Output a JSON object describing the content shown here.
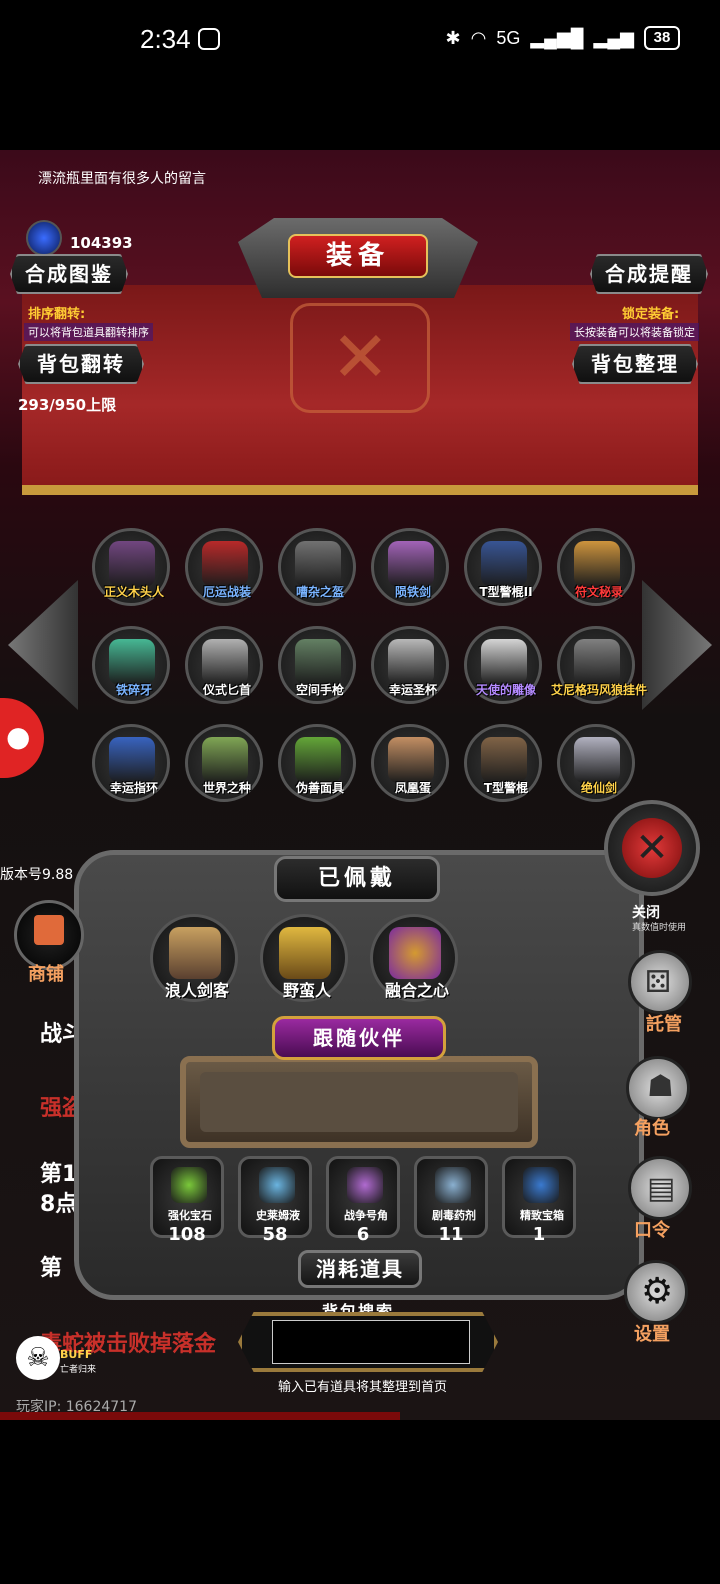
{
  "status_bar": {
    "time": "2:34",
    "network": "5G",
    "wifi_badge": "6",
    "battery": "38"
  },
  "header": {
    "scroll_message": "漂流瓶里面有很多人的留言",
    "gem_count": "104393",
    "title": "装备",
    "codex_button": "合成图鉴",
    "reminder_button": "合成提醒"
  },
  "drape": {
    "sort_label": "排序翻转:",
    "sort_hint": "可以将背包道具翻转排序",
    "lock_label": "锁定装备:",
    "lock_hint": "长按装备可以将装备锁定",
    "flip_button": "背包翻转",
    "tidy_button": "背包整理",
    "capacity": "293/950上限"
  },
  "items": [
    {
      "label": "正义木头人",
      "color": "#ffd24a"
    },
    {
      "label": "厄运战装",
      "color": "#7ab4ff"
    },
    {
      "label": "嘈杂之盔",
      "color": "#7ab4ff"
    },
    {
      "label": "陨铁剑",
      "color": "#7ab4ff"
    },
    {
      "label": "T型警棍II",
      "color": "#ffffff"
    },
    {
      "label": "符文秘录",
      "color": "#ff3a3a"
    },
    {
      "label": "铁碎牙",
      "color": "#7ab4ff"
    },
    {
      "label": "仪式匕首",
      "color": "#ffffff"
    },
    {
      "label": "空间手枪",
      "color": "#ffffff"
    },
    {
      "label": "幸运圣杯",
      "color": "#ffffff"
    },
    {
      "label": "天使的雕像",
      "color": "#b48aff"
    },
    {
      "label": "艾尼格玛风狼挂件",
      "color": "#ffd24a"
    },
    {
      "label": "幸运指环",
      "color": "#ffffff"
    },
    {
      "label": "世界之种",
      "color": "#ffffff"
    },
    {
      "label": "伪善面具",
      "color": "#ffffff"
    },
    {
      "label": "凤凰蛋",
      "color": "#ffffff"
    },
    {
      "label": "T型警棍",
      "color": "#ffffff"
    },
    {
      "label": "绝仙剑",
      "color": "#ffd24a"
    }
  ],
  "version": "版本号9.88",
  "worn": {
    "title": "已佩戴",
    "items": [
      "浪人剑客",
      "野蛮人",
      "融合之心"
    ]
  },
  "follower": {
    "title": "跟随伙伴"
  },
  "consumables": {
    "title": "消耗道具",
    "items": [
      {
        "label": "强化宝石",
        "qty": "108"
      },
      {
        "label": "史莱姆液",
        "qty": "58"
      },
      {
        "label": "战争号角",
        "qty": "6"
      },
      {
        "label": "剧毒药剂",
        "qty": "11"
      },
      {
        "label": "精致宝箱",
        "qty": "1"
      }
    ]
  },
  "search": {
    "label": "背包搜索",
    "value": "",
    "hint": "输入已有道具将其整理到首页"
  },
  "side": {
    "shop": "商铺",
    "close": "关闭",
    "close_sub": "真数值时使用",
    "manage": "託管",
    "role": "角色",
    "code": "口令",
    "settings": "设置"
  },
  "background_text": {
    "line1": "战斗",
    "line2": "强盗",
    "line3": "第1",
    "line4": "8点",
    "line5": "第",
    "line6": "毒蛇被击败掉落金"
  },
  "buff": {
    "label": "BUFF",
    "sub": "亡者归来"
  },
  "player_ip": "玩家IP: 16624717"
}
